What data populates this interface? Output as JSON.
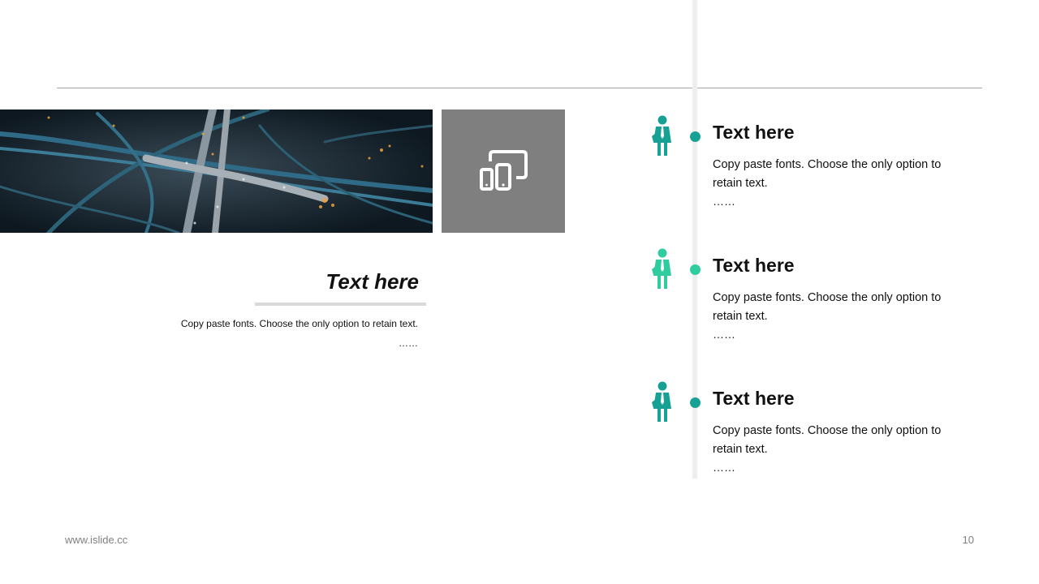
{
  "left_panel": {
    "title": "Text here",
    "body": "Copy paste fonts. Choose the only option to retain text.",
    "ellipsis": "……"
  },
  "icon_tile": {
    "icon": "devices-icon",
    "background": "#7f7f7f"
  },
  "items": [
    {
      "title": "Text here",
      "body": "Copy paste fonts. Choose the only option to retain text.",
      "ellipsis": "……",
      "color": "#17a094",
      "icon": "businessman-icon"
    },
    {
      "title": "Text here",
      "body": "Copy paste fonts. Choose the only option to retain text.",
      "ellipsis": "……",
      "color": "#2ecc9f",
      "icon": "businessman-icon"
    },
    {
      "title": "Text here",
      "body": "Copy paste fonts. Choose the only option to retain text.",
      "ellipsis": "……",
      "color": "#17a094",
      "icon": "businessman-icon"
    }
  ],
  "footer": {
    "url": "www.islide.cc",
    "page": "10"
  }
}
